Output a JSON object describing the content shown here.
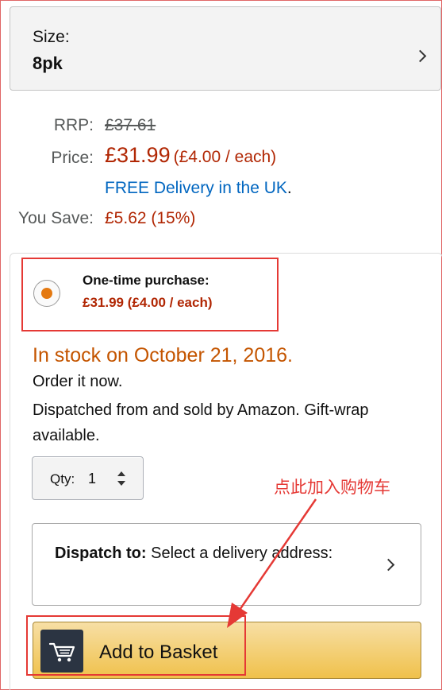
{
  "size": {
    "label": "Size:",
    "value": "8pk"
  },
  "pricing": {
    "rrp_label": "RRP:",
    "rrp_value": "£37.61",
    "price_label": "Price:",
    "price_value": "£31.99",
    "price_each": "(£4.00 / each)",
    "free_delivery": "FREE Delivery in the UK",
    "free_delivery_dot": ".",
    "save_label": "You Save:",
    "save_value": "£5.62 (15%)"
  },
  "purchase_option": {
    "title": "One-time purchase:",
    "price": "£31.99 (£4.00 / each)",
    "selected": true
  },
  "availability": {
    "stock": "In stock on October 21, 2016.",
    "order_now": "Order it now.",
    "dispatched": "Dispatched from and sold by Amazon. Gift-wrap available."
  },
  "quantity": {
    "label": "Qty:",
    "value": "1"
  },
  "dispatch": {
    "bold": "Dispatch to:",
    "text": "Select a delivery address:"
  },
  "add_to_basket": {
    "label": "Add to Basket"
  },
  "annotation": {
    "text": "点此加入购物车",
    "color": "#e53935"
  },
  "colors": {
    "price_red": "#b12704",
    "link_blue": "#0066c0",
    "stock_orange": "#c45500",
    "radio_orange": "#e47911",
    "button_yellow": "#f0c14b"
  },
  "icons": [
    "chevron-right-icon",
    "radio-selected-icon",
    "up-down-icon",
    "cart-icon"
  ]
}
